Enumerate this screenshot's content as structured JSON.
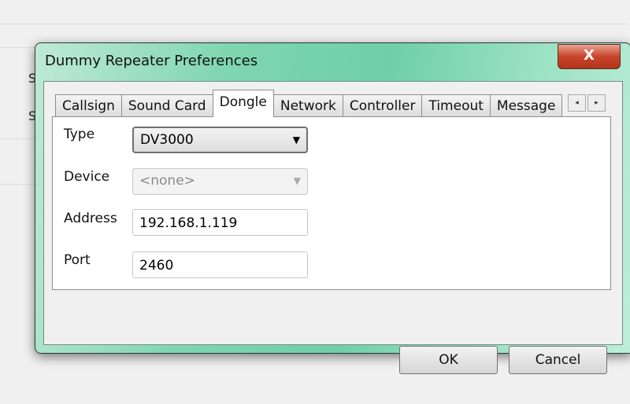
{
  "dialog": {
    "title": "Dummy Repeater Preferences",
    "close_label": "X"
  },
  "background": {
    "partial_labels": [
      "S",
      "S"
    ]
  },
  "tabs": [
    {
      "label": "Callsign"
    },
    {
      "label": "Sound Card"
    },
    {
      "label": "Dongle",
      "active": true
    },
    {
      "label": "Network"
    },
    {
      "label": "Controller"
    },
    {
      "label": "Timeout"
    },
    {
      "label": "Message"
    }
  ],
  "tab_scroll": {
    "left": "◂",
    "right": "▸"
  },
  "form": {
    "type": {
      "label": "Type",
      "value": "DV3000"
    },
    "device": {
      "label": "Device",
      "value": "<none>"
    },
    "address": {
      "label": "Address",
      "value": "192.168.1.119"
    },
    "port": {
      "label": "Port",
      "value": "2460"
    }
  },
  "buttons": {
    "ok": "OK",
    "cancel": "Cancel"
  }
}
